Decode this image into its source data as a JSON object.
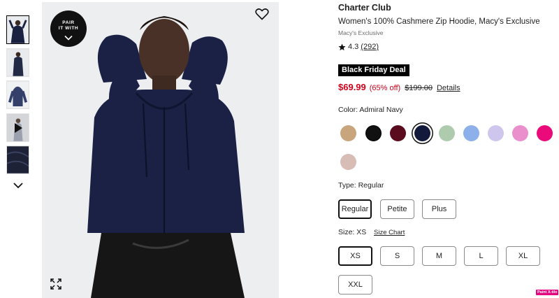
{
  "product": {
    "brand": "Charter Club",
    "title": "Women's 100% Cashmere Zip Hoodie, Macy's Exclusive",
    "exclusive": "Macy's Exclusive",
    "rating": "4.3",
    "review_count": "(292)",
    "deal_badge": "Black Friday Deal",
    "sale_price": "$69.99",
    "discount": "(65% off)",
    "original_price": "$199.00",
    "details_link": "Details"
  },
  "gallery": {
    "pair_badge_line1": "PAIR",
    "pair_badge_line2": "IT WITH",
    "active_thumb": 1
  },
  "color": {
    "label": "Color: Admiral Navy",
    "swatches": [
      {
        "name": "Camel",
        "hex": "#c8a57c"
      },
      {
        "name": "Black",
        "hex": "#111111"
      },
      {
        "name": "Burgundy",
        "hex": "#5a0b1e"
      },
      {
        "name": "Admiral Navy",
        "hex": "#13193a",
        "selected": true
      },
      {
        "name": "Sage",
        "hex": "#aecbae"
      },
      {
        "name": "Light Blue",
        "hex": "#8eb0ea"
      },
      {
        "name": "Lavender",
        "hex": "#cfc6ee"
      },
      {
        "name": "Pink",
        "hex": "#ea8fcc"
      },
      {
        "name": "Hot Pink",
        "hex": "#ea0a7a"
      },
      {
        "name": "Blush Heather",
        "hex": "#d8bcb6"
      }
    ]
  },
  "type": {
    "label": "Type: Regular",
    "options": [
      "Regular",
      "Petite",
      "Plus"
    ],
    "selected": "Regular"
  },
  "size": {
    "label": "Size: XS",
    "chart_link": "Size Chart",
    "options": [
      "XS",
      "S",
      "M",
      "L",
      "XL",
      "XXL"
    ],
    "selected": "XS"
  },
  "corner_badge": "Paint X-tile",
  "colors": {
    "sale_red": "#d0021b",
    "text": "#1f1f1f",
    "border": "#8a8a8a"
  }
}
